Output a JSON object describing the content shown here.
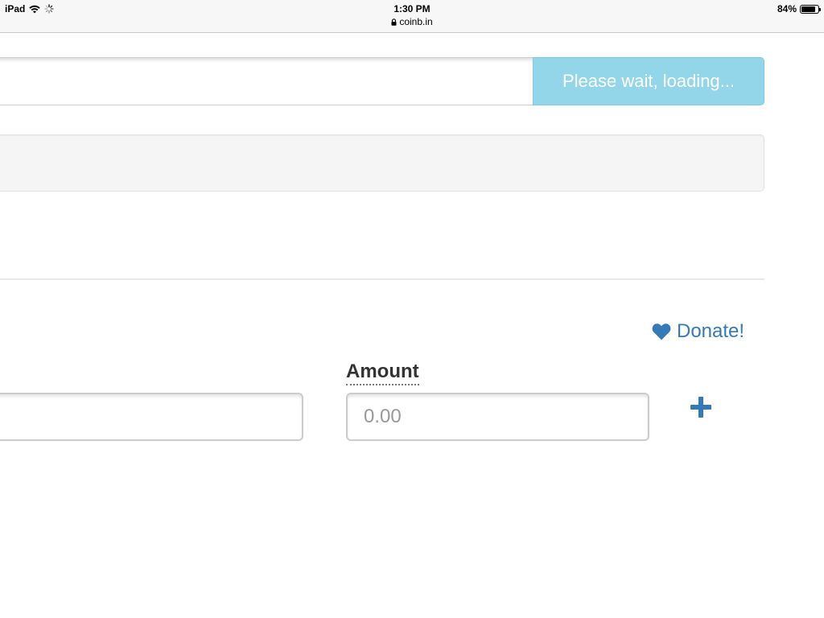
{
  "status_bar": {
    "device": "iPad",
    "time": "1:30 PM",
    "url": "coinb.in",
    "battery": "84%",
    "battery_level": 0.84,
    "icons": [
      "wifi-icon",
      "loading-spinner-icon",
      "lock-icon",
      "battery-icon"
    ]
  },
  "top_form": {
    "input_value": "",
    "button_label": "Please wait, loading..."
  },
  "donate": {
    "label": "Donate!",
    "icon": "heart-icon"
  },
  "output_row": {
    "address_value": "",
    "amount_label": "Amount",
    "amount_placeholder": "0.00",
    "add_icon": "plus-icon"
  },
  "colors": {
    "loading_button_bg": "#94d6e9",
    "link_blue": "#337ab7",
    "well_bg": "#f5f5f5"
  }
}
